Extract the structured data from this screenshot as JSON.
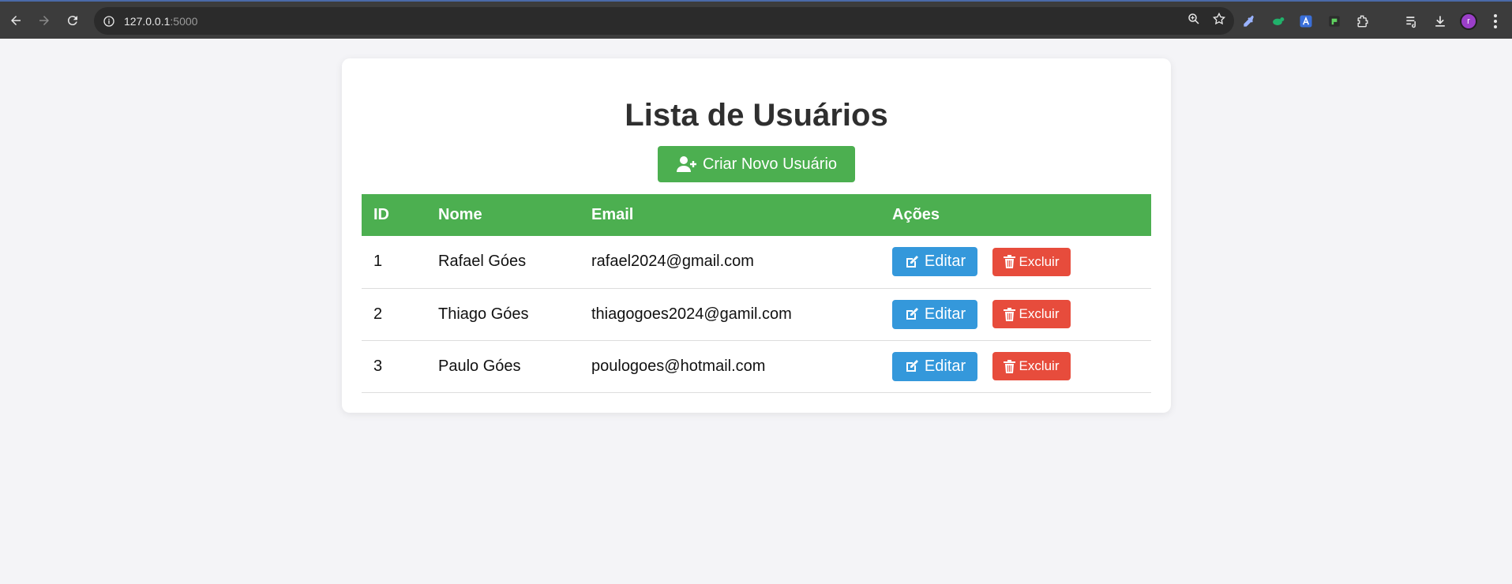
{
  "browser": {
    "url_host": "127.0.0.1",
    "url_port": ":5000",
    "avatar_letter": "r"
  },
  "page": {
    "title": "Lista de Usuários",
    "create_button_label": "Criar Novo Usuário"
  },
  "table": {
    "headers": [
      "ID",
      "Nome",
      "Email",
      "Ações"
    ],
    "rows": [
      {
        "id": "1",
        "nome": "Rafael Góes",
        "email": "rafael2024@gmail.com"
      },
      {
        "id": "2",
        "nome": "Thiago Góes",
        "email": "thiagogoes2024@gamil.com"
      },
      {
        "id": "3",
        "nome": "Paulo Góes",
        "email": "poulogoes@hotmail.com"
      }
    ],
    "edit_label": "Editar",
    "delete_label": "Excluir"
  },
  "colors": {
    "primary_green": "#4caf50",
    "edit_blue": "#3498db",
    "delete_red": "#e74c3c"
  }
}
